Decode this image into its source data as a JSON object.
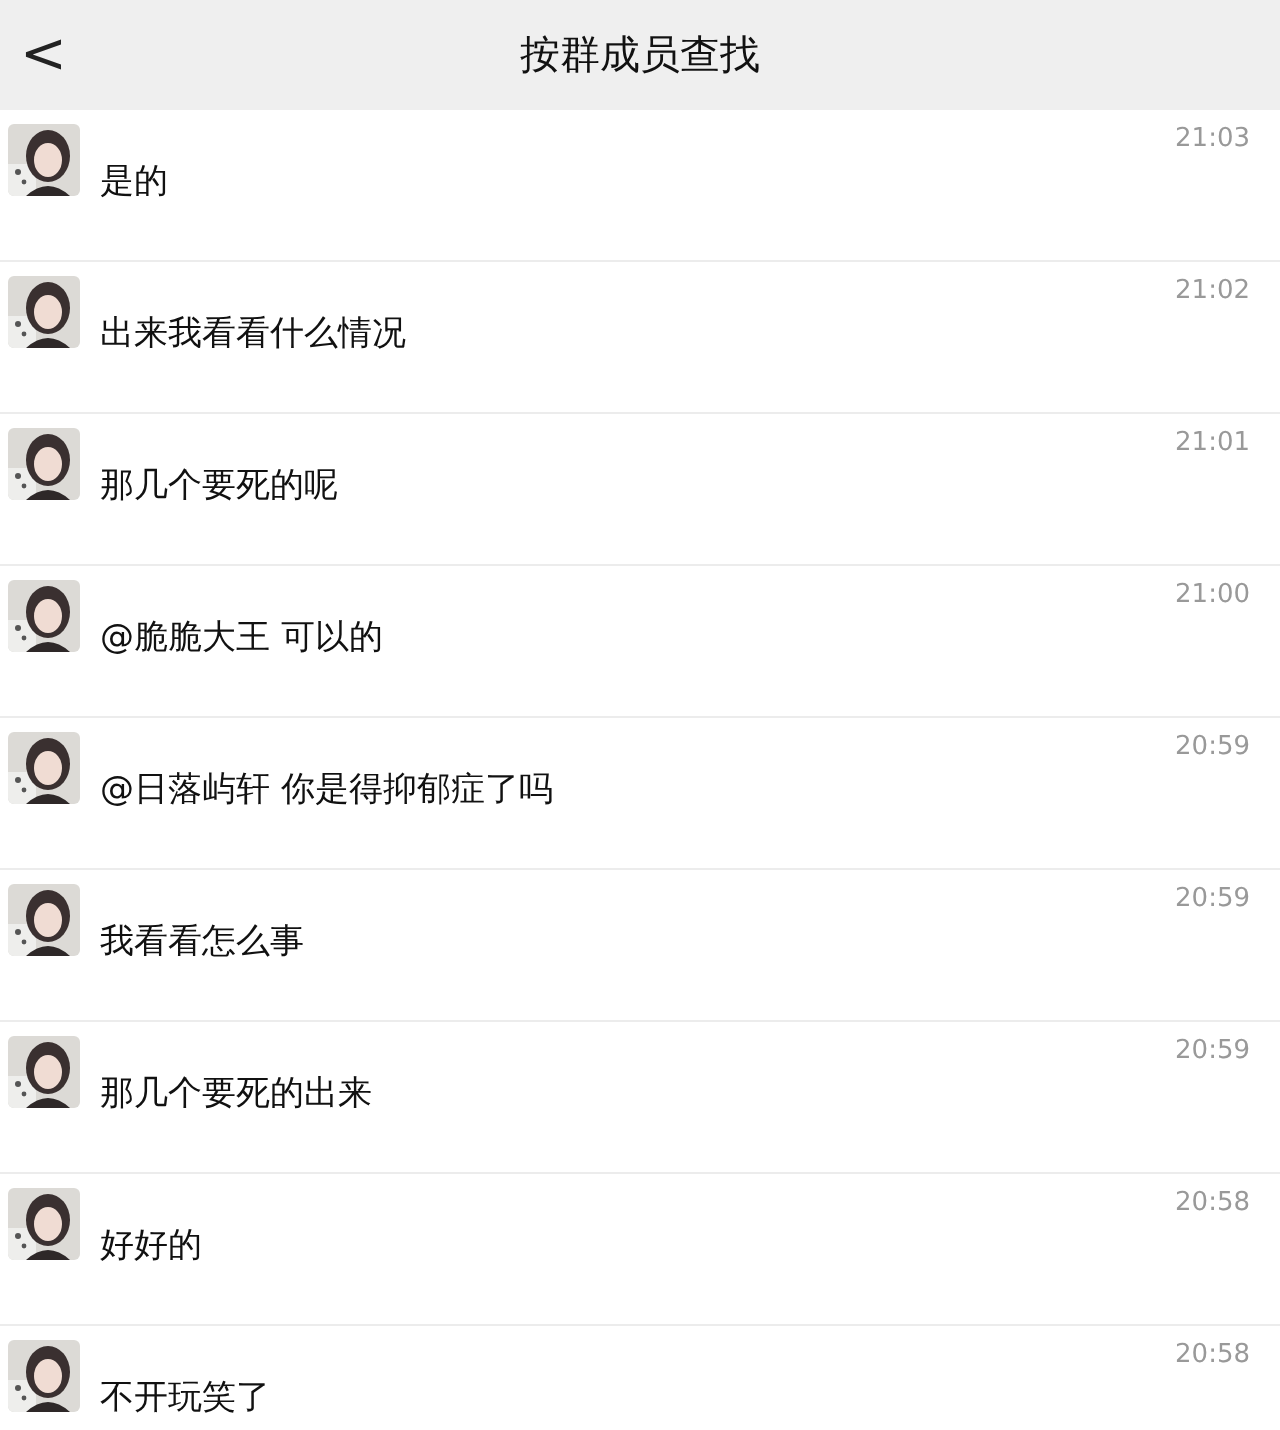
{
  "header": {
    "back": "<",
    "title": "按群成员查找"
  },
  "messages": [
    {
      "text": "是的",
      "time": "21:03"
    },
    {
      "text": "出来我看看什么情况",
      "time": "21:02"
    },
    {
      "text": "那几个要死的呢",
      "time": "21:01"
    },
    {
      "text": "@脆脆大王 可以的",
      "time": "21:00"
    },
    {
      "text": "@日落屿轩 你是得抑郁症了吗",
      "time": "20:59"
    },
    {
      "text": "我看看怎么事",
      "time": "20:59"
    },
    {
      "text": "那几个要死的出来",
      "time": "20:59"
    },
    {
      "text": "好好的",
      "time": "20:58"
    },
    {
      "text": "不开玩笑了",
      "time": "20:58"
    }
  ]
}
